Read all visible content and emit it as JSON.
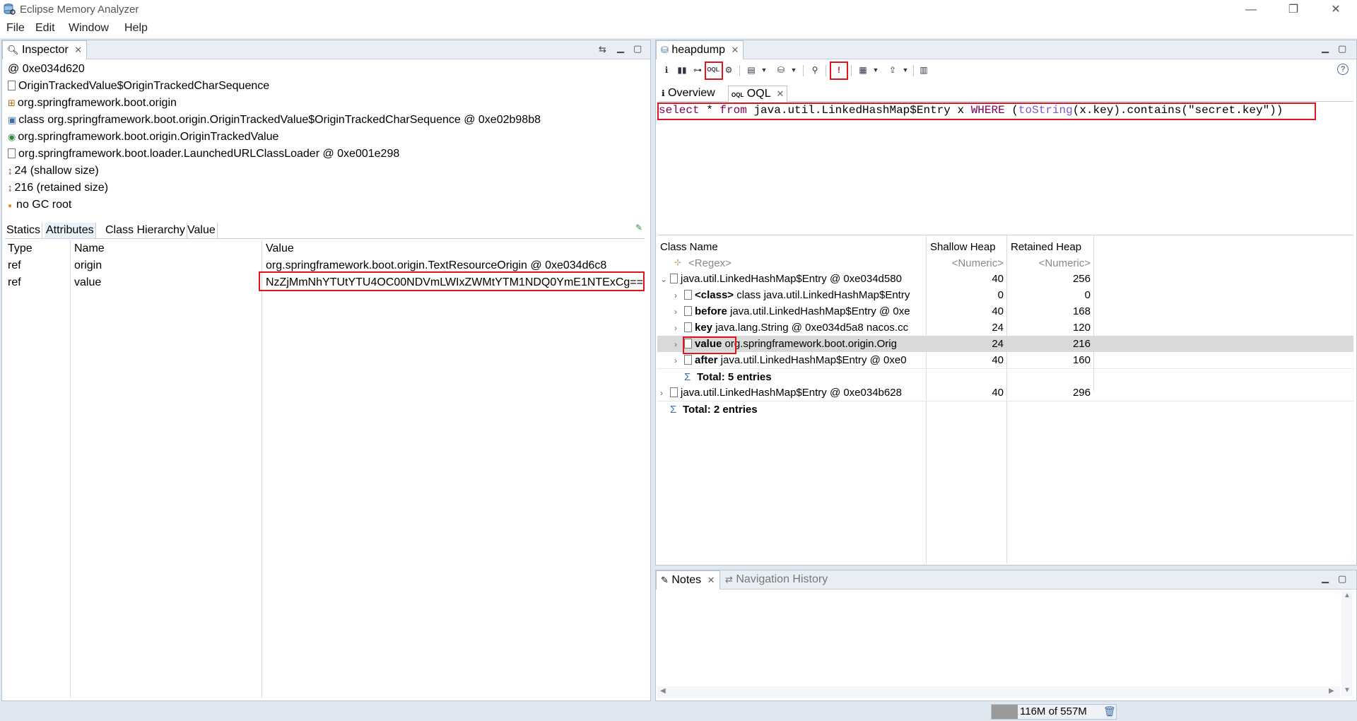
{
  "window": {
    "title": "Eclipse Memory Analyzer",
    "controls": {
      "minimize": "—",
      "restore": "❐",
      "close": "✕"
    }
  },
  "menu": {
    "items": [
      {
        "label": "File"
      },
      {
        "label": "Edit"
      },
      {
        "label": "Window"
      },
      {
        "label": "Help"
      }
    ]
  },
  "inspector": {
    "tab_label": "Inspector",
    "rows": [
      {
        "icon": "address-icon",
        "text": "@ 0xe034d620"
      },
      {
        "icon": "object-icon",
        "text": "OriginTrackedValue$OriginTrackedCharSequence"
      },
      {
        "icon": "package-icon",
        "text": "org.springframework.boot.origin"
      },
      {
        "icon": "class-icon",
        "text": "class org.springframework.boot.origin.OriginTrackedValue$OriginTrackedCharSequence @ 0xe02b98b8"
      },
      {
        "icon": "superclass-icon",
        "text": "org.springframework.boot.origin.OriginTrackedValue"
      },
      {
        "icon": "classloader-icon",
        "text": "org.springframework.boot.loader.LaunchedURLClassLoader @ 0xe001e298"
      },
      {
        "icon": "size-icon",
        "text": "24 (shallow size)"
      },
      {
        "icon": "size-icon",
        "text": "216 (retained size)"
      },
      {
        "icon": "gcroot-icon",
        "text": "no GC root"
      }
    ],
    "subtabs": [
      "Statics",
      "Attributes",
      "Class Hierarchy",
      "Value"
    ],
    "active_subtab": "Attributes",
    "attributes": {
      "columns": [
        "Type",
        "Name",
        "Value"
      ],
      "rows": [
        {
          "type": "ref",
          "name": "origin",
          "value": "org.springframework.boot.origin.TextResourceOrigin @ 0xe034d6c8"
        },
        {
          "type": "ref",
          "name": "value",
          "value": "NzZjMmNhYTUtYTU4OC00NDVmLWIxZWMtYTM1NDQ0YmE1NTExCg=="
        }
      ]
    }
  },
  "heapdump": {
    "tab_label": "heapdump",
    "inner_tabs": [
      {
        "label": "Overview"
      },
      {
        "label": "OQL"
      }
    ],
    "query": {
      "select": "select",
      "star": " * ",
      "from": "from",
      "cls": " java.util.LinkedHashMap$Entry x ",
      "where": "WHERE",
      "open": " (",
      "fn": "toString",
      "rest": "(x.key).contains(\"secret.key\"))"
    },
    "columns": [
      "Class Name",
      "Shallow Heap",
      "Retained Heap"
    ],
    "filters": {
      "regex": "<Regex>",
      "numeric1": "<Numeric>",
      "numeric2": "<Numeric>"
    },
    "rows": [
      {
        "indent": 0,
        "chev": "⌄",
        "bold": "",
        "text": "java.util.LinkedHashMap$Entry @ 0xe034d580",
        "shallow": "40",
        "retained": "256"
      },
      {
        "indent": 1,
        "chev": "›",
        "bold": "<class>",
        "text": " class java.util.LinkedHashMap$Entry",
        "shallow": "0",
        "retained": "0"
      },
      {
        "indent": 1,
        "chev": "›",
        "bold": "before",
        "text": " java.util.LinkedHashMap$Entry @ 0xe",
        "shallow": "40",
        "retained": "168"
      },
      {
        "indent": 1,
        "chev": "›",
        "bold": "key",
        "text": " java.lang.String @ 0xe034d5a8  nacos.cc",
        "shallow": "24",
        "retained": "120"
      },
      {
        "indent": 1,
        "chev": "›",
        "bold": "value",
        "text": " org.springframework.boot.origin.Orig",
        "shallow": "24",
        "retained": "216"
      },
      {
        "indent": 1,
        "chev": "›",
        "bold": "after",
        "text": " java.util.LinkedHashMap$Entry @ 0xe0",
        "shallow": "40",
        "retained": "160"
      },
      {
        "indent": 1,
        "chev": "",
        "bold": "Total: 5 entries",
        "text": "",
        "shallow": "",
        "retained": ""
      },
      {
        "indent": 0,
        "chev": "›",
        "bold": "",
        "text": "java.util.LinkedHashMap$Entry @ 0xe034b628",
        "shallow": "40",
        "retained": "296"
      },
      {
        "indent": 0,
        "chev": "",
        "bold": "Total: 2 entries",
        "text": "",
        "shallow": "",
        "retained": ""
      }
    ]
  },
  "notes": {
    "tab_label": "Notes",
    "other_tab_label": "Navigation History"
  },
  "status": {
    "memory": "116M of 557M"
  }
}
